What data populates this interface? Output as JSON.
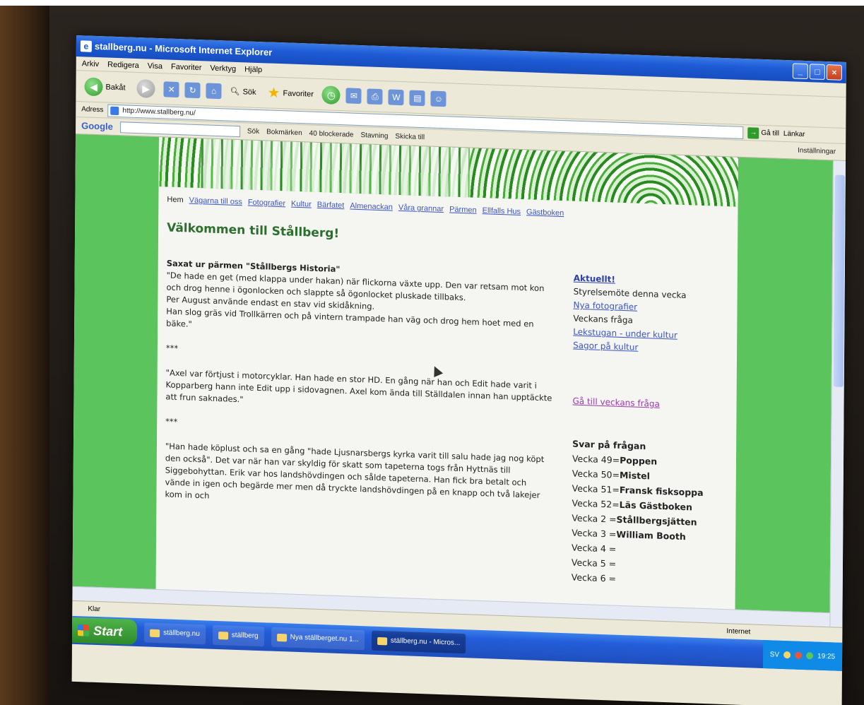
{
  "window": {
    "title": "stallberg.nu - Microsoft Internet Explorer",
    "buttons": [
      "_",
      "□",
      "×"
    ]
  },
  "menu": [
    "Arkiv",
    "Redigera",
    "Visa",
    "Favoriter",
    "Verktyg",
    "Hjälp"
  ],
  "toolbar": {
    "back_label": "Bakåt",
    "search_label": "Sök",
    "favorites_label": "Favoriter"
  },
  "address": {
    "label": "Adress",
    "url": "http://www.stallberg.nu/",
    "go_label": "Gå till",
    "links_label": "Länkar"
  },
  "googlebar": {
    "logo": "Google",
    "search_label": "Sök",
    "bookmarks_label": "Bokmärken",
    "blocked_label": "40 blockerade",
    "spelling_label": "Stavning",
    "send_label": "Skicka till",
    "settings_label": "Inställningar"
  },
  "site": {
    "nav": {
      "home": "Hem",
      "items": [
        "Vägarna till oss",
        "Fotografier",
        "Kultur",
        "Bärfatet",
        "Almenackan",
        "Våra grannar",
        "Pärmen",
        "Ellfalls Hus",
        "Gästboken"
      ]
    },
    "heading": "Välkommen till Stållberg!",
    "main": {
      "quote_title": "Saxat ur pärmen \"Stållbergs Historia\"",
      "paragraph1": "\"De hade en get (med klappa under hakan) när flickorna växte upp. Den var retsam mot kon och drog henne i ögonlocken och slappte så ögonlocket pluskade tillbaks.",
      "paragraph2": "Per August använde endast en stav vid skidåkning.",
      "paragraph3": "Han slog gräs vid Trollkärren och på vintern trampade han väg och drog hem hoet med en bäke.\"",
      "separator1": "***",
      "paragraph4": "\"Axel var förtjust i motorcyklar. Han hade en stor HD. En gång när han och Edit hade varit i Kopparberg hann inte Edit upp i sidovagnen. Axel kom ända till Ställdalen innan han upptäckte att frun saknades.\"",
      "separator2": "***",
      "paragraph5": "\"Han hade köplust och sa en gång \"hade Ljusnarsbergs kyrka varit till salu hade jag nog köpt den också\". Det var när han var skyldig för skatt som tapeterna togs från Hyttnäs till Siggebohyttan. Erik var hos landshövdingen och sålde tapeterna. Han fick bra betalt och vände in igen och begärde mer men då tryckte landshövdingen på en knapp och två lakejer kom in och"
    },
    "side": {
      "header": "Aktuellt!",
      "items": [
        {
          "text": "Styrelsemöte denna vecka",
          "link": false
        },
        {
          "text": "Nya fotografier",
          "link": true
        },
        {
          "text": "Veckans fråga",
          "link": false
        },
        {
          "text": "Lekstugan - under kultur",
          "link": true
        },
        {
          "text": "Sagor på kultur",
          "link": true
        }
      ],
      "question_link": "Gå till veckans fråga",
      "answers_title": "Svar på frågan",
      "answers": [
        {
          "week": "Vecka 49=",
          "answer": "Poppen"
        },
        {
          "week": "Vecka 50=",
          "answer": "Mistel"
        },
        {
          "week": "Vecka 51=",
          "answer": "Fransk fisksoppa"
        },
        {
          "week": "Vecka 52=",
          "answer": "Läs Gästboken"
        },
        {
          "week": "Vecka 2 =",
          "answer": "Stållbergsjätten"
        },
        {
          "week": "Vecka 3 =",
          "answer": "William Booth"
        },
        {
          "week": "Vecka 4 =",
          "answer": ""
        },
        {
          "week": "Vecka 5 =",
          "answer": ""
        },
        {
          "week": "Vecka 6 =",
          "answer": ""
        }
      ]
    }
  },
  "status": {
    "left": "Klar",
    "zone": "Internet"
  },
  "taskbar": {
    "start": "Start",
    "tasks": [
      "ställberg.nu",
      "ställberg",
      "Nya ställberget.nu 1...",
      "ställberg.nu - Micros..."
    ],
    "clock": "19:25",
    "lang": "SV"
  },
  "colors": {
    "bg_green": "#5cc45c",
    "xp_blue": "#245edb",
    "link_blue": "#3a55c8",
    "heading_green": "#2c6f2c"
  }
}
